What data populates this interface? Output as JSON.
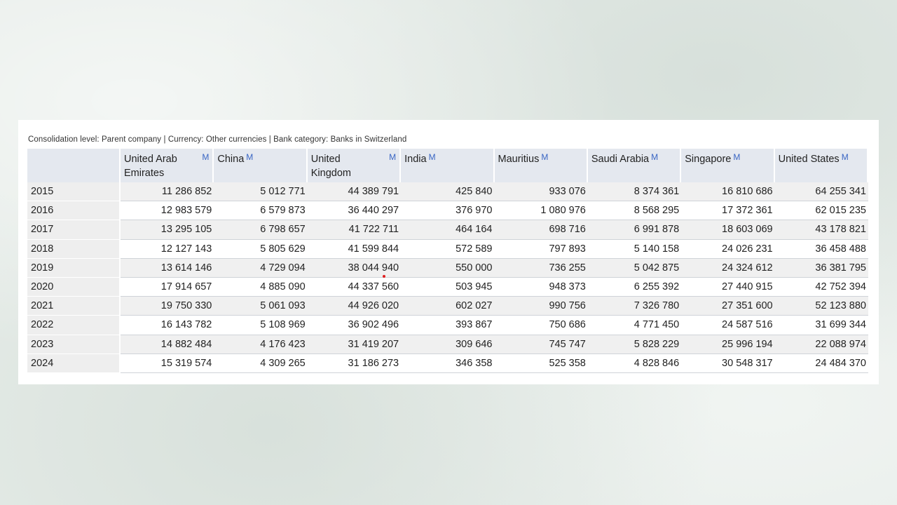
{
  "caption": "Consolidation level: Parent company | Currency: Other currencies | Bank category: Banks in Switzerland",
  "colors": {
    "header_bg": "#e4e8ef",
    "badge": "#3a66c4",
    "row_alt": "#f0f0f0",
    "year_bg": "#eeeeee"
  },
  "chart_data": {
    "type": "table",
    "badge": "M",
    "columns": [
      {
        "label": "United Arab Emirates",
        "line1": "United Arab",
        "line2": "Emirates",
        "badge_right": true
      },
      {
        "label": "China",
        "line1": "China",
        "line2": "",
        "badge_right": false
      },
      {
        "label": "United Kingdom",
        "line1": "United",
        "line2": "Kingdom",
        "badge_right": true
      },
      {
        "label": "India",
        "line1": "India",
        "line2": "",
        "badge_right": false
      },
      {
        "label": "Mauritius",
        "line1": "Mauritius",
        "line2": "",
        "badge_right": false
      },
      {
        "label": "Saudi Arabia",
        "line1": "Saudi Arabia",
        "line2": "",
        "badge_right": false
      },
      {
        "label": "Singapore",
        "line1": "Singapore",
        "line2": "",
        "badge_right": false
      },
      {
        "label": "United States",
        "line1": "United States",
        "line2": "",
        "badge_right": false
      }
    ],
    "rows": [
      {
        "year": "2015",
        "values": [
          "11 286 852",
          "5 012 771",
          "44 389 791",
          "425 840",
          "933 076",
          "8 374 361",
          "16 810 686",
          "64 255 341"
        ]
      },
      {
        "year": "2016",
        "values": [
          "12 983 579",
          "6 579 873",
          "36 440 297",
          "376 970",
          "1 080 976",
          "8 568 295",
          "17 372 361",
          "62 015 235"
        ]
      },
      {
        "year": "2017",
        "values": [
          "13 295 105",
          "6 798 657",
          "41 722 711",
          "464 164",
          "698 716",
          "6 991 878",
          "18 603 069",
          "43 178 821"
        ]
      },
      {
        "year": "2018",
        "values": [
          "12 127 143",
          "5 805 629",
          "41 599 844",
          "572 589",
          "797 893",
          "5 140 158",
          "24 026 231",
          "36 458 488"
        ]
      },
      {
        "year": "2019",
        "values": [
          "13 614 146",
          "4 729 094",
          "38 044 940",
          "550 000",
          "736 255",
          "5 042 875",
          "24 324 612",
          "36 381 795"
        ]
      },
      {
        "year": "2020",
        "values": [
          "17 914 657",
          "4 885 090",
          "44 337 560",
          "503 945",
          "948 373",
          "6 255 392",
          "27 440 915",
          "42 752 394"
        ]
      },
      {
        "year": "2021",
        "values": [
          "19 750 330",
          "5 061 093",
          "44 926 020",
          "602 027",
          "990 756",
          "7 326 780",
          "27 351 600",
          "52 123 880"
        ]
      },
      {
        "year": "2022",
        "values": [
          "16 143 782",
          "5 108 969",
          "36 902 496",
          "393 867",
          "750 686",
          "4 771 450",
          "24 587 516",
          "31 699 344"
        ]
      },
      {
        "year": "2023",
        "values": [
          "14 882 484",
          "4 176 423",
          "31 419 207",
          "309 646",
          "745 747",
          "5 828 229",
          "25 996 194",
          "22 088 974"
        ]
      },
      {
        "year": "2024",
        "values": [
          "15 319 574",
          "4 309 265",
          "31 186 273",
          "346 358",
          "525 358",
          "4 828 846",
          "30 548 317",
          "24 484 370"
        ]
      }
    ]
  }
}
